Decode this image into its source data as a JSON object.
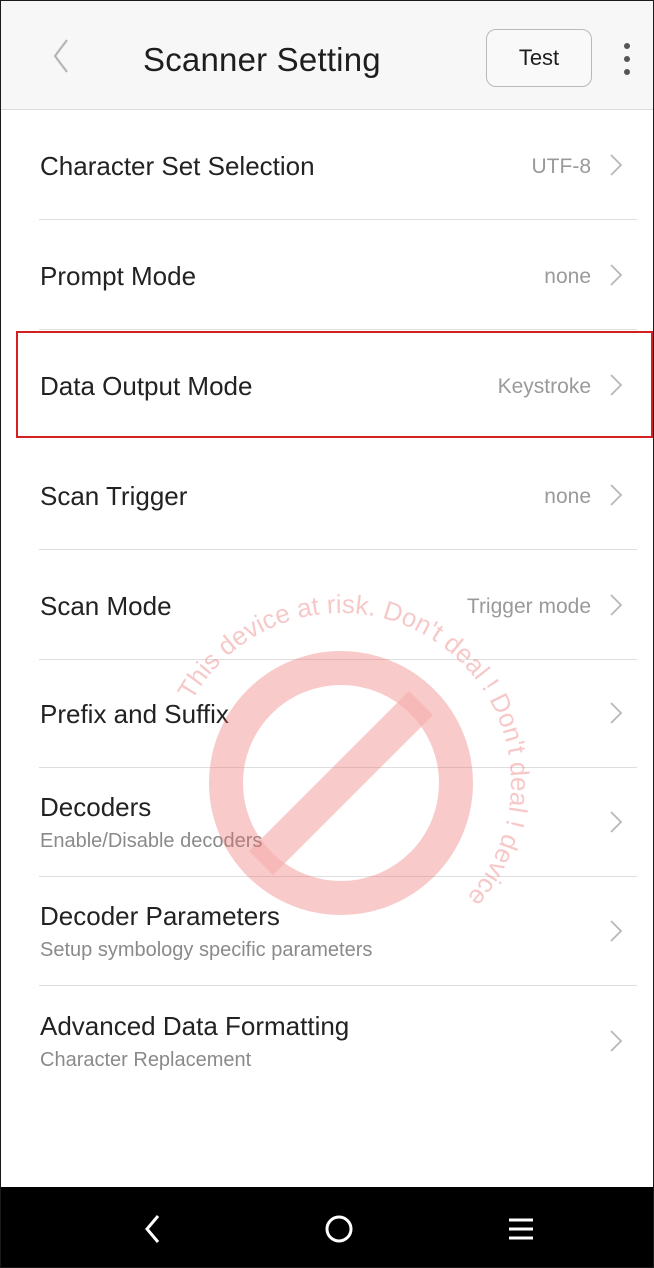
{
  "header": {
    "title": "Scanner Setting",
    "test_label": "Test",
    "back_icon": "chevron-left-icon",
    "more_icon": "more-vertical-icon"
  },
  "settings": [
    {
      "label": "Character Set Selection",
      "value": "UTF-8"
    },
    {
      "label": "Prompt Mode",
      "value": "none"
    },
    {
      "label": "Data Output Mode",
      "value": "Keystroke",
      "highlighted": true
    },
    {
      "label": "Scan Trigger",
      "value": "none"
    },
    {
      "label": "Scan Mode",
      "value": "Trigger mode"
    },
    {
      "label": "Prefix and Suffix"
    },
    {
      "label": "Decoders",
      "subtitle": "Enable/Disable decoders"
    },
    {
      "label": "Decoder Parameters",
      "subtitle": "Setup symbology specific parameters"
    },
    {
      "label": "Advanced Data Formatting",
      "subtitle": "Character Replacement"
    }
  ],
  "watermark": {
    "text": "This device at risk. Don't deal ! Don't deal ! device",
    "color": "#e23030"
  },
  "navbar": {
    "items": [
      "back-icon",
      "home-icon",
      "menu-icon"
    ]
  },
  "colors": {
    "highlight_border": "#d32020",
    "header_bg": "#f7f7f7",
    "navbar_bg": "#000000"
  }
}
